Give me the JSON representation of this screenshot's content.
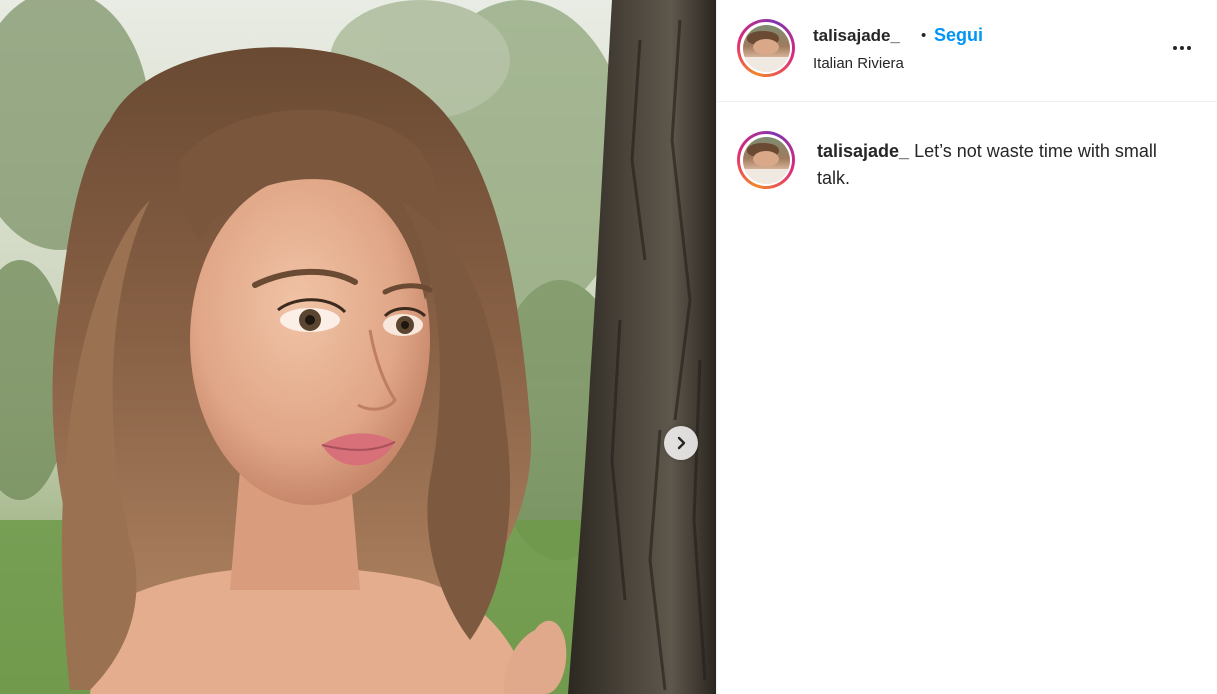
{
  "post": {
    "image_alt": "Photo of a young woman with shoulder-length brown hair leaning against an olive tree trunk"
  },
  "header": {
    "username": "talisajade_",
    "separator": "•",
    "follow_label": "Segui",
    "location": "Italian Riviera",
    "more_icon": "more-horizontal-icon"
  },
  "caption": {
    "username": "talisajade_",
    "text": "Let’s not waste time with small talk."
  },
  "colors": {
    "follow_blue": "#0095f6",
    "text": "#262626",
    "divider": "#efefef"
  }
}
